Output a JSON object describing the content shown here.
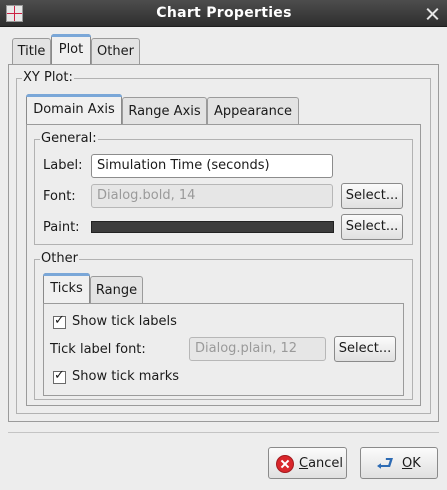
{
  "window": {
    "title": "Chart Properties"
  },
  "top_tabs": [
    "Title",
    "Plot",
    "Other"
  ],
  "plot_group": {
    "label": "XY Plot:"
  },
  "axis_tabs": [
    "Domain Axis",
    "Range Axis",
    "Appearance"
  ],
  "general": {
    "legend": "General:",
    "label_caption": "Label:",
    "label_value": "Simulation Time (seconds)",
    "font_caption": "Font:",
    "font_value": "Dialog.bold, 14",
    "paint_caption": "Paint:",
    "paint_color": "#3c3c3c",
    "select_label": "Select..."
  },
  "other": {
    "legend": "Other",
    "tabs": [
      "Ticks",
      "Range"
    ],
    "show_tick_labels": "Show tick labels",
    "tick_label_font_caption": "Tick label font:",
    "tick_label_font_value": "Dialog.plain, 12",
    "select_label": "Select...",
    "show_tick_marks": "Show tick marks"
  },
  "buttons": {
    "cancel_mnemonic": "C",
    "cancel_rest": "ancel",
    "ok_mnemonic": "O",
    "ok_rest": "K"
  }
}
